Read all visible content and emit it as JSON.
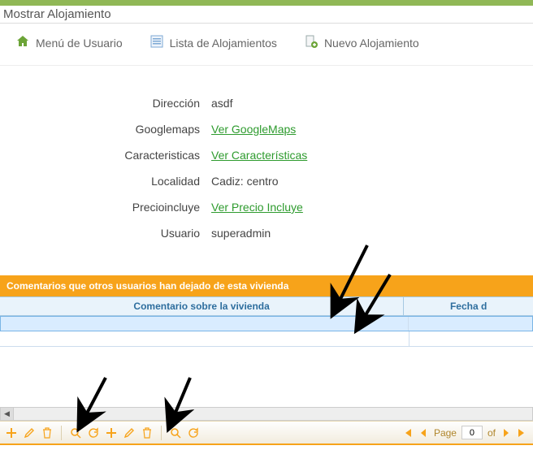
{
  "page_title": "Mostrar Alojamiento",
  "menu": {
    "user_menu": "Menú de Usuario",
    "list": "Lista de Alojamientos",
    "new": "Nuevo Alojamiento"
  },
  "details": {
    "direccion_label": "Dirección",
    "direccion_value": "asdf",
    "googlemaps_label": "Googlemaps",
    "googlemaps_link": "Ver GoogleMaps",
    "caracteristicas_label": "Caracteristicas",
    "caracteristicas_link": "Ver Características",
    "localidad_label": "Localidad",
    "localidad_value": "Cadiz: centro",
    "precioincluye_label": "Precioincluye",
    "precioincluye_link": "Ver Precio Incluye",
    "usuario_label": "Usuario",
    "usuario_value": "superadmin"
  },
  "grid": {
    "title": "Comentarios que otros usuarios han dejado de esta vivienda",
    "col_comment": "Comentario sobre la vivienda",
    "col_date": "Fecha d"
  },
  "pager": {
    "page_label": "Page",
    "page_value": "0",
    "of_label": "of"
  }
}
